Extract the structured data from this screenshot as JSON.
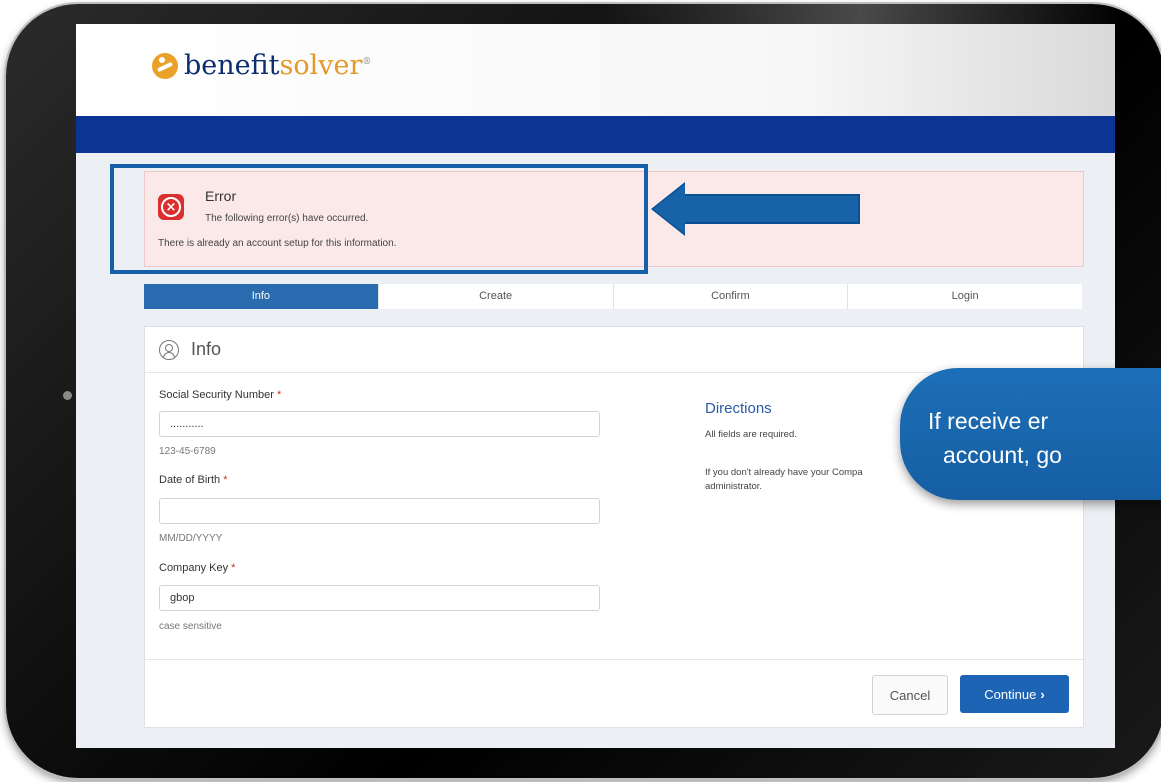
{
  "brand": {
    "name_part1": "benefit",
    "name_part2": "solver",
    "mark": "®"
  },
  "alert": {
    "title": "Error",
    "subtitle": "The following error(s) have occurred.",
    "message": "There is already an account setup for this information."
  },
  "steps": [
    {
      "label": "Info",
      "active": true
    },
    {
      "label": "Create",
      "active": false
    },
    {
      "label": "Confirm",
      "active": false
    },
    {
      "label": "Login",
      "active": false
    }
  ],
  "card": {
    "title": "Info"
  },
  "form": {
    "ssn": {
      "label": "Social Security Number",
      "required": "*",
      "value": "...........",
      "help": "123-45-6789"
    },
    "dob": {
      "label": "Date of Birth",
      "required": "*",
      "value": "",
      "help": "MM/DD/YYYY"
    },
    "company_key": {
      "label": "Company Key",
      "required": "*",
      "value": "gbop",
      "help": "case sensitive"
    }
  },
  "directions": {
    "title": "Directions",
    "line1": "All fields are required.",
    "line2": "If you don't already have your Compa",
    "line3": "administrator."
  },
  "buttons": {
    "cancel": "Cancel",
    "continue": "Continue",
    "continue_icon": "›"
  },
  "callout": {
    "line1": "If receive er",
    "line2": "account, go"
  },
  "colors": {
    "navbar": "#0b3494",
    "accent": "#1e64b4",
    "error": "#d9302f",
    "highlight": "#1560a8"
  }
}
